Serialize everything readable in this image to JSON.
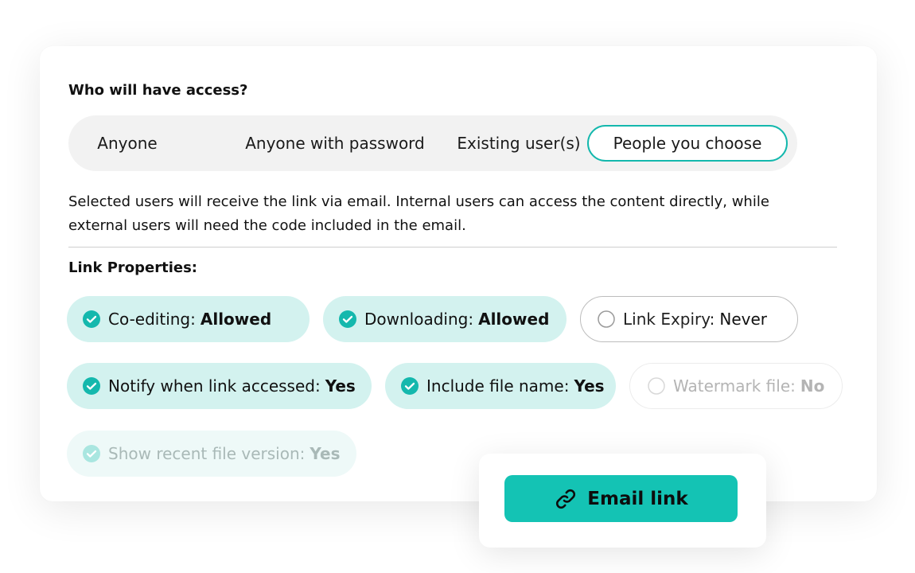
{
  "access": {
    "heading": "Who will have access?",
    "options": [
      {
        "label": "Anyone",
        "selected": false
      },
      {
        "label": "Anyone with password",
        "selected": false
      },
      {
        "label": "Existing user(s)",
        "selected": false
      },
      {
        "label": "People you choose",
        "selected": true
      }
    ],
    "description": "Selected users will receive the link via email. Internal users can access the content directly, while external users will need the code included in the email."
  },
  "properties": {
    "heading": "Link Properties:",
    "chips": [
      {
        "label": "Co-editing:",
        "value": "Allowed",
        "state": "checked",
        "icon": "check-circle-icon"
      },
      {
        "label": "Downloading:",
        "value": "Allowed",
        "state": "checked",
        "icon": "check-circle-icon"
      },
      {
        "label": "Link Expiry:",
        "value": "Never",
        "state": "unchecked",
        "icon": "empty-circle-icon"
      },
      {
        "label": "Notify when link accessed:",
        "value": "Yes",
        "state": "checked",
        "icon": "check-circle-icon"
      },
      {
        "label": "Include file name:",
        "value": "Yes",
        "state": "checked",
        "icon": "check-circle-icon"
      },
      {
        "label": "Watermark file:",
        "value": "No",
        "state": "disabled-unchecked",
        "icon": "empty-circle-icon"
      },
      {
        "label": "Show recent file version:",
        "value": "Yes",
        "state": "disabled-checked",
        "icon": "check-circle-icon"
      }
    ]
  },
  "action": {
    "email_label": "Email link",
    "icon": "link-icon"
  },
  "colors": {
    "accent": "#14b8ad",
    "button": "#14c3b4",
    "chip_on": "#d3f2ef"
  }
}
